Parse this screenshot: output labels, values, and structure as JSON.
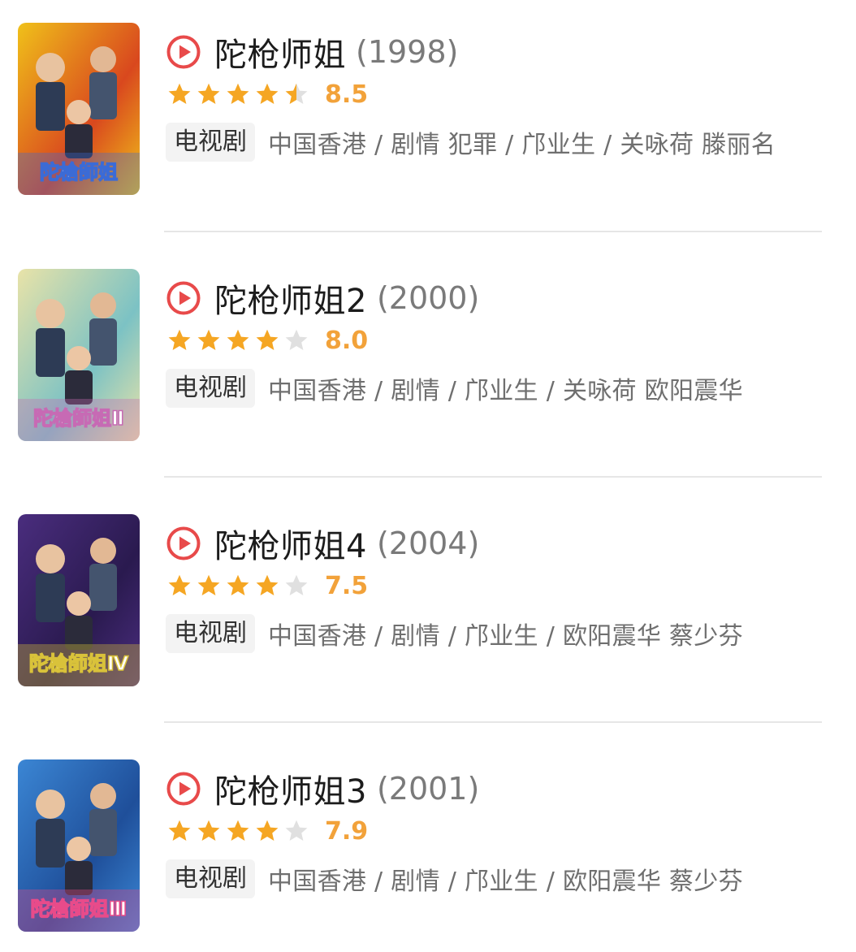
{
  "colors": {
    "accent_star": "#f5a623",
    "empty_star": "#e0e0e0",
    "play_icon": "#e84a4a",
    "score": "#f2a23a"
  },
  "items": [
    {
      "title": "陀枪师姐",
      "year": "(1998)",
      "score": "8.5",
      "stars": 4.5,
      "tag": "电视剧",
      "info": "中国香港 / 剧情 犯罪 / 邝业生 / 关咏荷 滕丽名",
      "poster_text": "陀槍師姐",
      "poster_colors": [
        "#f0c11a",
        "#d9481e",
        "#3b6bd6"
      ]
    },
    {
      "title": "陀枪师姐2",
      "year": "(2000)",
      "score": "8.0",
      "stars": 4,
      "tag": "电视剧",
      "info": "中国香港 / 剧情 / 邝业生 / 关咏荷 欧阳震华",
      "poster_text": "陀槍師姐Ⅱ",
      "poster_colors": [
        "#e9e3a8",
        "#7cc2c4",
        "#c76ab4"
      ]
    },
    {
      "title": "陀枪师姐4",
      "year": "(2004)",
      "score": "7.5",
      "stars": 4,
      "tag": "电视剧",
      "info": "中国香港 / 剧情 / 邝业生 / 欧阳震华 蔡少芬",
      "poster_text": "陀槍師姐Ⅳ",
      "poster_colors": [
        "#4a2d7e",
        "#2a1a4f",
        "#d9c23a"
      ]
    },
    {
      "title": "陀枪师姐3",
      "year": "(2001)",
      "score": "7.9",
      "stars": 4,
      "tag": "电视剧",
      "info": "中国香港 / 剧情 / 邝业生 / 欧阳震华 蔡少芬",
      "poster_text": "陀槍師姐Ⅲ",
      "poster_colors": [
        "#3b86d4",
        "#1f4f9a",
        "#e84b8a"
      ]
    }
  ]
}
